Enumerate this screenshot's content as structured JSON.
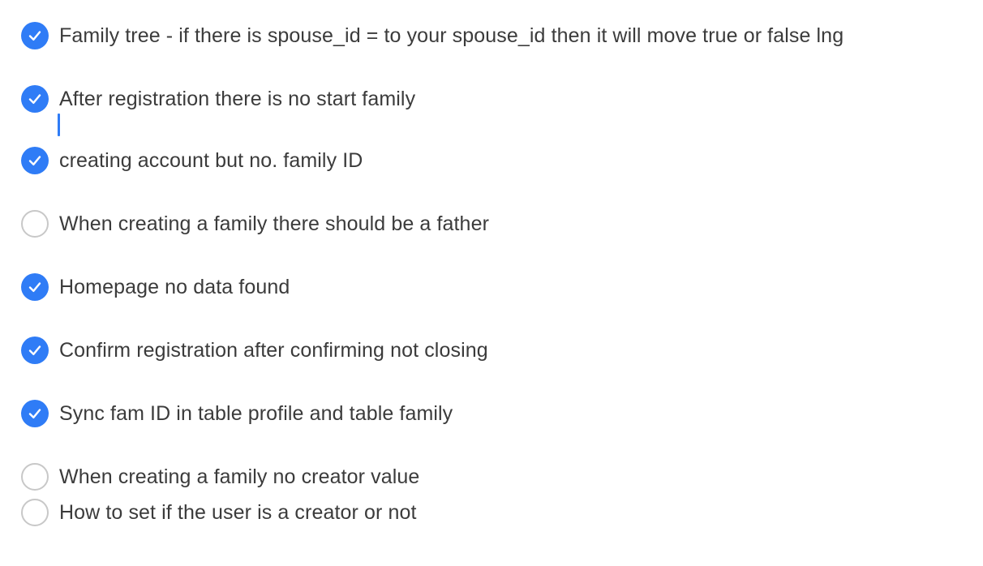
{
  "checklist": {
    "items": [
      {
        "label": "Family tree - if there is spouse_id = to your spouse_id then it will move true or false lng",
        "checked": true
      },
      {
        "label": "After registration there is no start family",
        "checked": true
      },
      {
        "label": "creating account but no. family ID",
        "checked": true
      },
      {
        "label": "When creating a family there should be a father",
        "checked": false
      },
      {
        "label": "Homepage no data found",
        "checked": true
      },
      {
        "label": "Confirm registration  after confirming not closing",
        "checked": true
      },
      {
        "label": "Sync fam ID in table profile and table family",
        "checked": true
      },
      {
        "label": "When creating a family no creator value",
        "checked": false
      },
      {
        "label": "How to set if the user is a creator or not",
        "checked": false
      }
    ]
  },
  "icons": {
    "checked": "checkmark-icon",
    "unchecked": "empty-circle-icon"
  },
  "colors": {
    "accent": "#2f7cf6",
    "unchecked_border": "#c8c8c8",
    "text": "#3b3b3b"
  }
}
